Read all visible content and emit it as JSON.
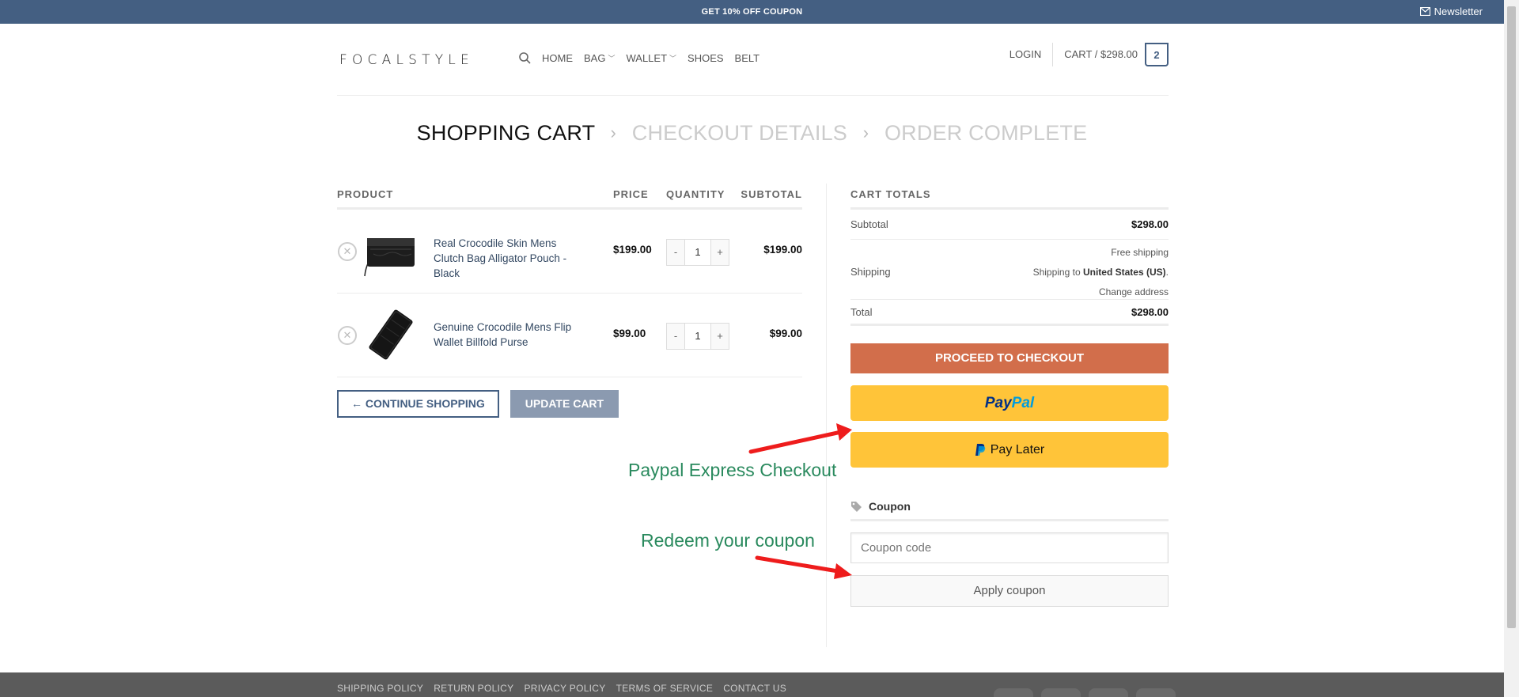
{
  "topbar": {
    "promo": "GET 10% OFF COUPON",
    "newsletter": "Newsletter"
  },
  "header": {
    "logo": "FOCALSTYLE",
    "nav": [
      "HOME",
      "BAG",
      "WALLET",
      "SHOES",
      "BELT"
    ],
    "login": "LOGIN",
    "cart": "CART / $298.00",
    "cart_count": "2"
  },
  "steps": {
    "cart": "SHOPPING CART",
    "checkout": "CHECKOUT DETAILS",
    "complete": "ORDER COMPLETE"
  },
  "table": {
    "headers": {
      "product": "PRODUCT",
      "price": "PRICE",
      "quantity": "QUANTITY",
      "subtotal": "SUBTOTAL"
    },
    "items": [
      {
        "name": "Real Crocodile Skin Mens Clutch Bag Alligator Pouch - Black",
        "price": "$199.00",
        "qty": "1",
        "subtotal": "$199.00"
      },
      {
        "name": "Genuine Crocodile Mens Flip Wallet Billfold Purse",
        "price": "$99.00",
        "qty": "1",
        "subtotal": "$99.00"
      }
    ],
    "continue": "← CONTINUE SHOPPING",
    "update": "UPDATE CART"
  },
  "totals": {
    "head": "CART TOTALS",
    "subtotal_label": "Subtotal",
    "subtotal": "$298.00",
    "shipping_label": "Shipping",
    "shipping_method": "Free shipping",
    "shipping_to": "Shipping to",
    "shipping_country": "United States (US)",
    "change_address": "Change address",
    "total_label": "Total",
    "total": "$298.00",
    "checkout": "PROCEED TO CHECKOUT",
    "paypal_a": "Pay",
    "paypal_b": "Pal",
    "paylater": "Pay Later",
    "coupon_head": "Coupon",
    "coupon_placeholder": "Coupon code",
    "apply": "Apply coupon"
  },
  "annotations": {
    "paypal": "Paypal Express Checkout",
    "coupon": "Redeem your coupon"
  },
  "footer": {
    "links": [
      "SHIPPING POLICY",
      "RETURN POLICY",
      "PRIVACY POLICY",
      "TERMS OF SERVICE",
      "CONTACT US"
    ]
  },
  "colors": {
    "brand": "#445f82",
    "checkout": "#d26e4b",
    "paypal": "#ffc439",
    "annotation": "#2a8a5e",
    "arrow": "#ee1c1c"
  }
}
